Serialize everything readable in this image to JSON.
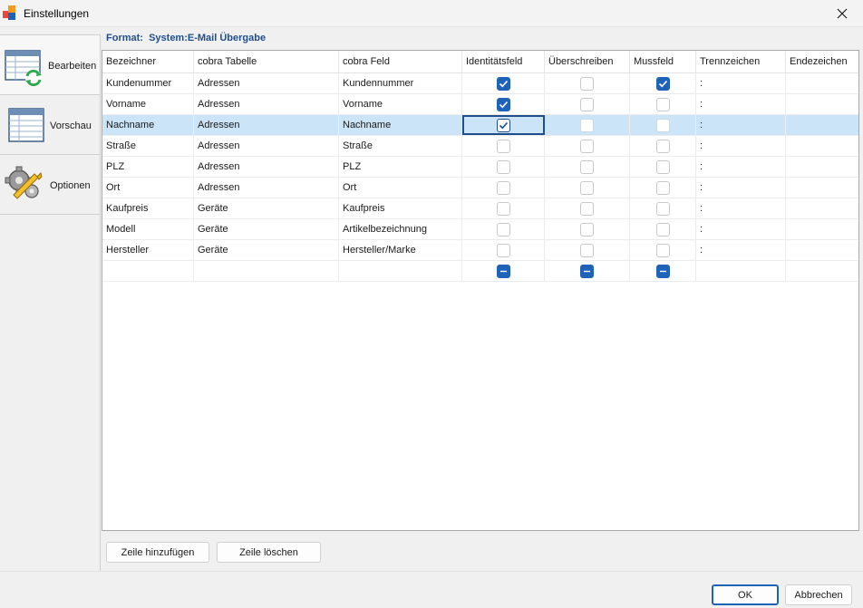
{
  "window": {
    "title": "Einstellungen"
  },
  "sidebar": {
    "items": [
      {
        "label": "Bearbeiten",
        "icon": "table-refresh-icon"
      },
      {
        "label": "Vorschau",
        "icon": "table-preview-icon"
      },
      {
        "label": "Optionen",
        "icon": "gears-wrench-icon"
      }
    ]
  },
  "main": {
    "format_label": "Format:",
    "format_value": "System:E-Mail Übergabe",
    "columns": [
      "Bezeichner",
      "cobra Tabelle",
      "cobra Feld",
      "Identitätsfeld",
      "Überschreiben",
      "Mussfeld",
      "Trennzeichen",
      "Endezeichen"
    ],
    "rows": [
      {
        "bezeichner": "Kundenummer",
        "tabelle": "Adressen",
        "feld": "Kundennummer",
        "identitaet": "checked",
        "ueberschreiben": "unchecked",
        "muss": "checked",
        "trenn": ":",
        "ende": ""
      },
      {
        "bezeichner": "Vorname",
        "tabelle": "Adressen",
        "feld": "Vorname",
        "identitaet": "checked",
        "ueberschreiben": "unchecked",
        "muss": "unchecked",
        "trenn": ":",
        "ende": ""
      },
      {
        "bezeichner": "Nachname",
        "tabelle": "Adressen",
        "feld": "Nachname",
        "identitaet": "checked",
        "ueberschreiben": "unchecked",
        "muss": "unchecked",
        "trenn": ":",
        "ende": ""
      },
      {
        "bezeichner": "Straße",
        "tabelle": "Adressen",
        "feld": "Straße",
        "identitaet": "unchecked",
        "ueberschreiben": "unchecked",
        "muss": "unchecked",
        "trenn": ":",
        "ende": ""
      },
      {
        "bezeichner": "PLZ",
        "tabelle": "Adressen",
        "feld": "PLZ",
        "identitaet": "unchecked",
        "ueberschreiben": "unchecked",
        "muss": "unchecked",
        "trenn": ":",
        "ende": ""
      },
      {
        "bezeichner": "Ort",
        "tabelle": "Adressen",
        "feld": "Ort",
        "identitaet": "unchecked",
        "ueberschreiben": "unchecked",
        "muss": "unchecked",
        "trenn": ":",
        "ende": ""
      },
      {
        "bezeichner": "Kaufpreis",
        "tabelle": "Geräte",
        "feld": "Kaufpreis",
        "identitaet": "unchecked",
        "ueberschreiben": "unchecked",
        "muss": "unchecked",
        "trenn": ":",
        "ende": ""
      },
      {
        "bezeichner": "Modell",
        "tabelle": "Geräte",
        "feld": "Artikelbezeichnung",
        "identitaet": "unchecked",
        "ueberschreiben": "unchecked",
        "muss": "unchecked",
        "trenn": ":",
        "ende": ""
      },
      {
        "bezeichner": "Hersteller",
        "tabelle": "Geräte",
        "feld": "Hersteller/Marke",
        "identitaet": "unchecked",
        "ueberschreiben": "unchecked",
        "muss": "unchecked",
        "trenn": ":",
        "ende": ""
      },
      {
        "bezeichner": "",
        "tabelle": "",
        "feld": "",
        "identitaet": "indeterminate",
        "ueberschreiben": "indeterminate",
        "muss": "indeterminate",
        "trenn": "",
        "ende": ""
      }
    ],
    "selected_row": 2,
    "add_row_label": "Zeile hinzufügen",
    "delete_row_label": "Zeile löschen"
  },
  "footer": {
    "ok_label": "OK",
    "cancel_label": "Abbrechen"
  },
  "colors": {
    "accent": "#1f63b8",
    "selection": "#cce4f7",
    "format_text": "#1f4e8c"
  }
}
